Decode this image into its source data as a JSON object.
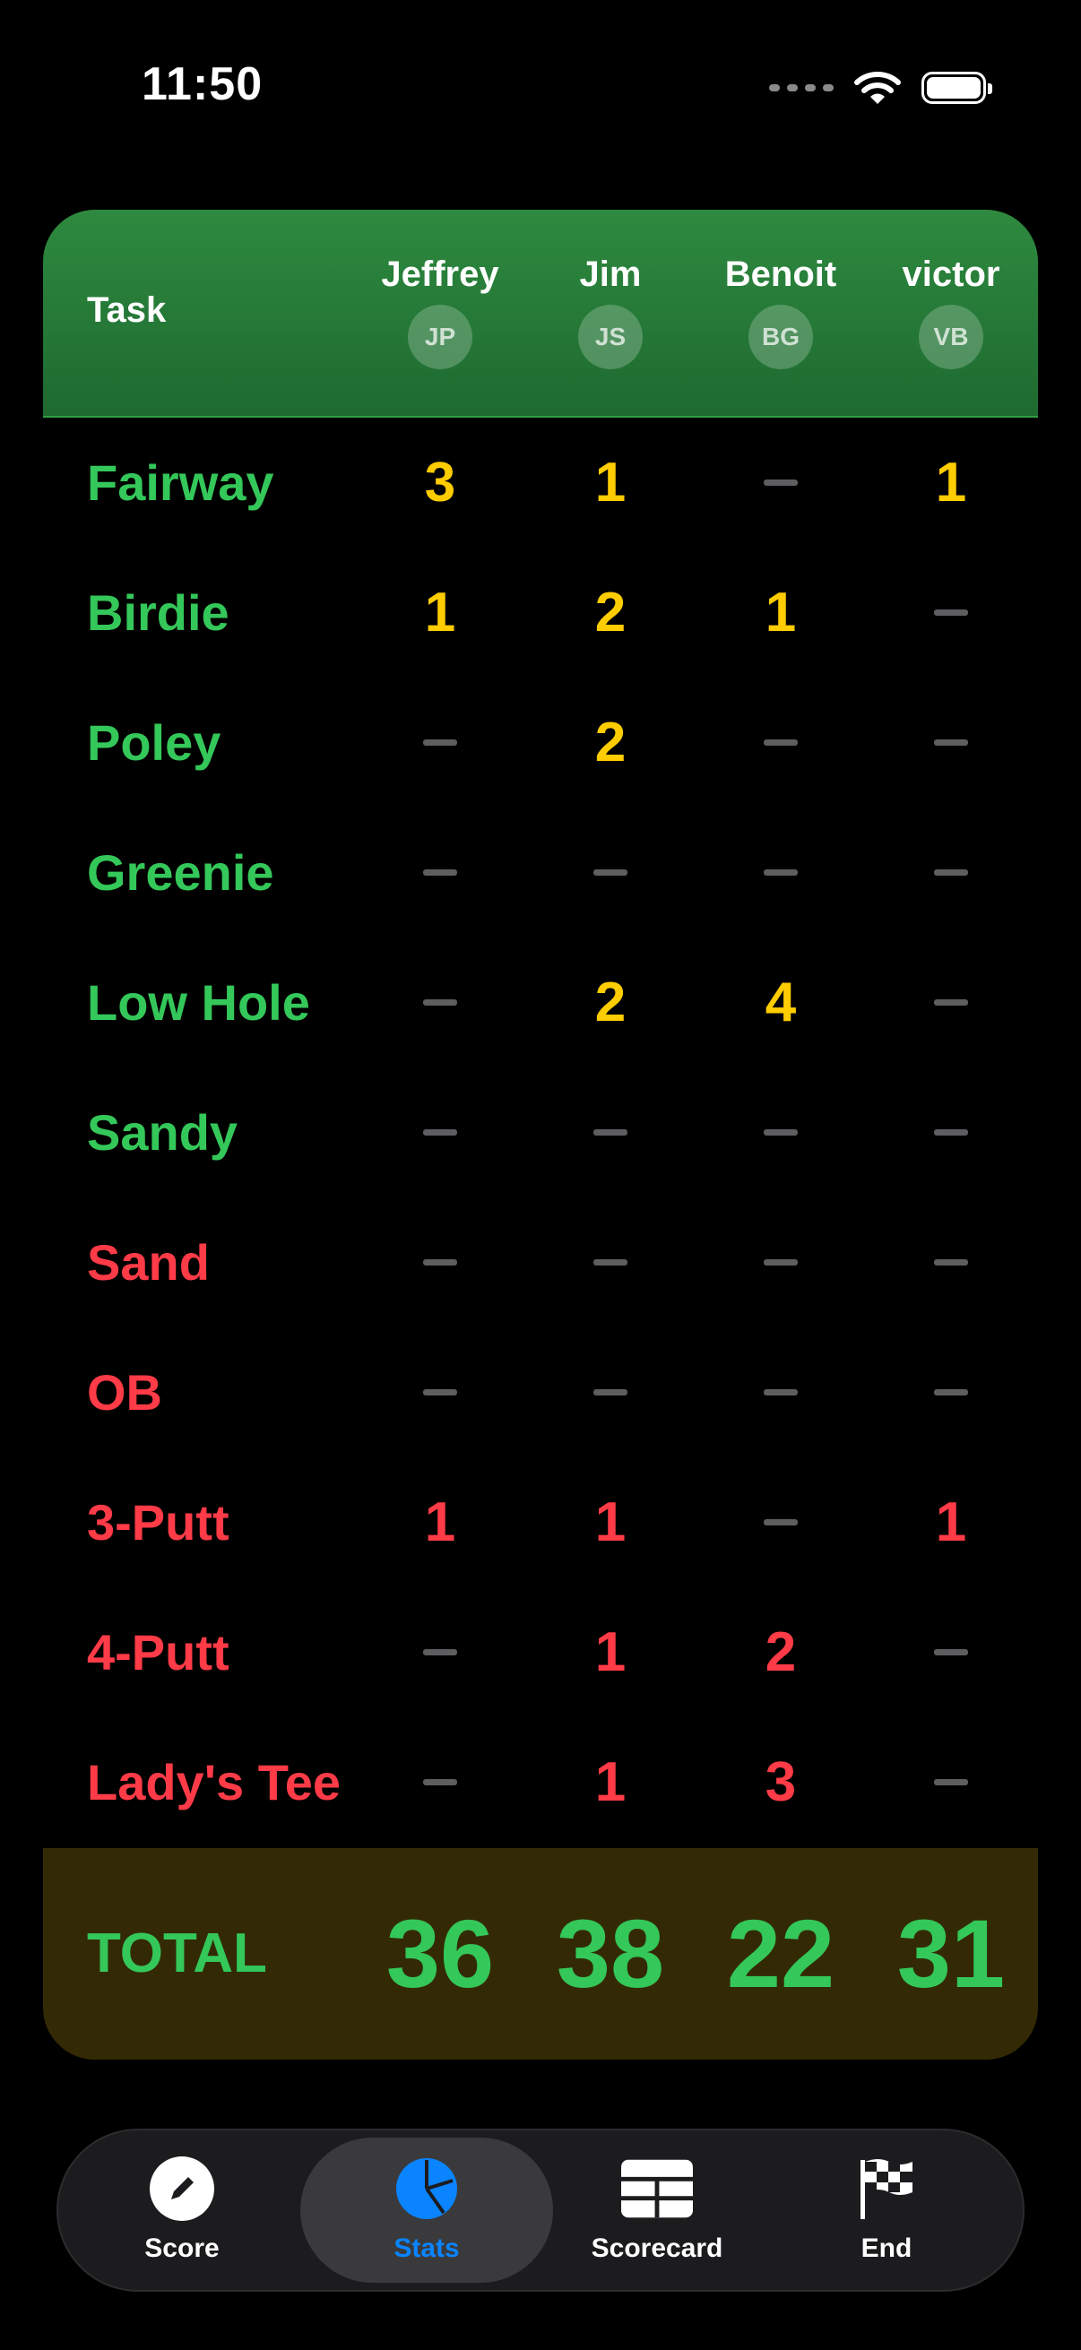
{
  "status": {
    "time": "11:50",
    "icons": [
      "signal-dots-icon",
      "wifi-icon",
      "battery-icon"
    ]
  },
  "table": {
    "task_header": "Task",
    "players": [
      {
        "name": "Jeffrey",
        "initials": "JP"
      },
      {
        "name": "Jim",
        "initials": "JS"
      },
      {
        "name": "Benoit",
        "initials": "BG"
      },
      {
        "name": "victor",
        "initials": "VB"
      }
    ],
    "rows": [
      {
        "task": "Fairway",
        "kind": "positive",
        "values": [
          "3",
          "1",
          "",
          "1"
        ]
      },
      {
        "task": "Birdie",
        "kind": "positive",
        "values": [
          "1",
          "2",
          "1",
          ""
        ]
      },
      {
        "task": "Poley",
        "kind": "positive",
        "values": [
          "",
          "2",
          "",
          ""
        ]
      },
      {
        "task": "Greenie",
        "kind": "positive",
        "values": [
          "",
          "",
          "",
          ""
        ]
      },
      {
        "task": "Low Hole",
        "kind": "positive",
        "values": [
          "",
          "2",
          "4",
          ""
        ]
      },
      {
        "task": "Sandy",
        "kind": "positive",
        "values": [
          "",
          "",
          "",
          ""
        ]
      },
      {
        "task": "Sand",
        "kind": "negative",
        "values": [
          "",
          "",
          "",
          ""
        ]
      },
      {
        "task": "OB",
        "kind": "negative",
        "values": [
          "",
          "",
          "",
          ""
        ]
      },
      {
        "task": "3-Putt",
        "kind": "negative",
        "values": [
          "1",
          "1",
          "",
          "1"
        ]
      },
      {
        "task": "4-Putt",
        "kind": "negative",
        "values": [
          "",
          "1",
          "2",
          ""
        ]
      },
      {
        "task": "Lady's Tee",
        "kind": "negative",
        "values": [
          "",
          "1",
          "3",
          ""
        ]
      }
    ],
    "total_label": "TOTAL",
    "totals": [
      "36",
      "38",
      "22",
      "31"
    ]
  },
  "colors": {
    "header_green": "#1e6a30",
    "positive_label": "#34c759",
    "negative_label": "#ff3b47",
    "positive_value": "#ffcc00",
    "total_bg": "#332a05",
    "active_tab": "#0a84ff"
  },
  "tabbar": {
    "tabs": [
      {
        "label": "Score",
        "icon": "pencil-icon",
        "active": false
      },
      {
        "label": "Stats",
        "icon": "pie-chart-icon",
        "active": true
      },
      {
        "label": "Scorecard",
        "icon": "table-icon",
        "active": false
      },
      {
        "label": "End",
        "icon": "checkered-flag-icon",
        "active": false
      }
    ]
  }
}
